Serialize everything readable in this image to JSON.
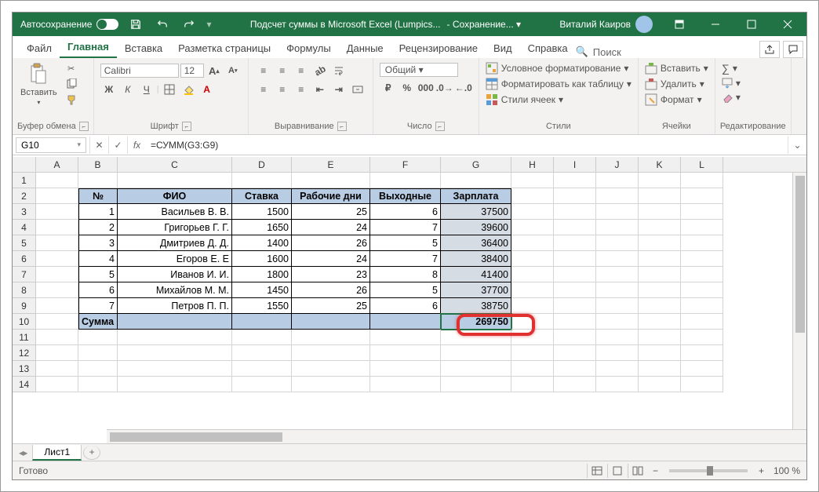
{
  "titlebar": {
    "autosave": "Автосохранение",
    "doc_title": "Подсчет суммы в Microsoft Excel (Lumpics...",
    "save_state": "Сохранение...",
    "user": "Виталий Каиров"
  },
  "tabs": {
    "file": "Файл",
    "home": "Главная",
    "insert": "Вставка",
    "layout": "Разметка страницы",
    "formulas": "Формулы",
    "data": "Данные",
    "review": "Рецензирование",
    "view": "Вид",
    "help": "Справка",
    "search": "Поиск"
  },
  "ribbon": {
    "clipboard": {
      "paste": "Вставить",
      "label": "Буфер обмена"
    },
    "font": {
      "name": "Calibri",
      "size": "12",
      "bold": "Ж",
      "italic": "К",
      "underline": "Ч",
      "label": "Шрифт"
    },
    "align": {
      "label": "Выравнивание"
    },
    "number": {
      "format": "Общий",
      "label": "Число"
    },
    "styles": {
      "cond": "Условное форматирование",
      "table": "Форматировать как таблицу",
      "cell": "Стили ячеек",
      "label": "Стили"
    },
    "cells": {
      "insert": "Вставить",
      "delete": "Удалить",
      "format": "Формат",
      "label": "Ячейки"
    },
    "editing": {
      "label": "Редактирование"
    }
  },
  "formula_bar": {
    "name_box": "G10",
    "formula": "=СУММ(G3:G9)"
  },
  "columns": [
    "A",
    "B",
    "C",
    "D",
    "E",
    "F",
    "G",
    "H",
    "I",
    "J",
    "K",
    "L"
  ],
  "row_numbers": [
    "1",
    "2",
    "3",
    "4",
    "5",
    "6",
    "7",
    "8",
    "9",
    "10",
    "11",
    "12",
    "13",
    "14"
  ],
  "table": {
    "headers": {
      "num": "№",
      "fio": "ФИО",
      "rate": "Ставка",
      "workdays": "Рабочие дни",
      "offdays": "Выходные",
      "salary": "Зарплата"
    },
    "rows": [
      {
        "n": "1",
        "fio": "Васильев В. В.",
        "rate": "1500",
        "wd": "25",
        "od": "6",
        "sal": "37500"
      },
      {
        "n": "2",
        "fio": "Григорьев Г. Г.",
        "rate": "1650",
        "wd": "24",
        "od": "7",
        "sal": "39600"
      },
      {
        "n": "3",
        "fio": "Дмитриев Д. Д.",
        "rate": "1400",
        "wd": "26",
        "od": "5",
        "sal": "36400"
      },
      {
        "n": "4",
        "fio": "Егоров Е. Е",
        "rate": "1600",
        "wd": "24",
        "od": "7",
        "sal": "38400"
      },
      {
        "n": "5",
        "fio": "Иванов И. И.",
        "rate": "1800",
        "wd": "23",
        "od": "8",
        "sal": "41400"
      },
      {
        "n": "6",
        "fio": "Михайлов М. М.",
        "rate": "1450",
        "wd": "26",
        "od": "5",
        "sal": "37700"
      },
      {
        "n": "7",
        "fio": "Петров П. П.",
        "rate": "1550",
        "wd": "25",
        "od": "6",
        "sal": "38750"
      }
    ],
    "sum_label": "Сумма",
    "sum_value": "269750"
  },
  "sheet": {
    "name": "Лист1"
  },
  "status": {
    "ready": "Готово",
    "zoom": "100 %"
  }
}
